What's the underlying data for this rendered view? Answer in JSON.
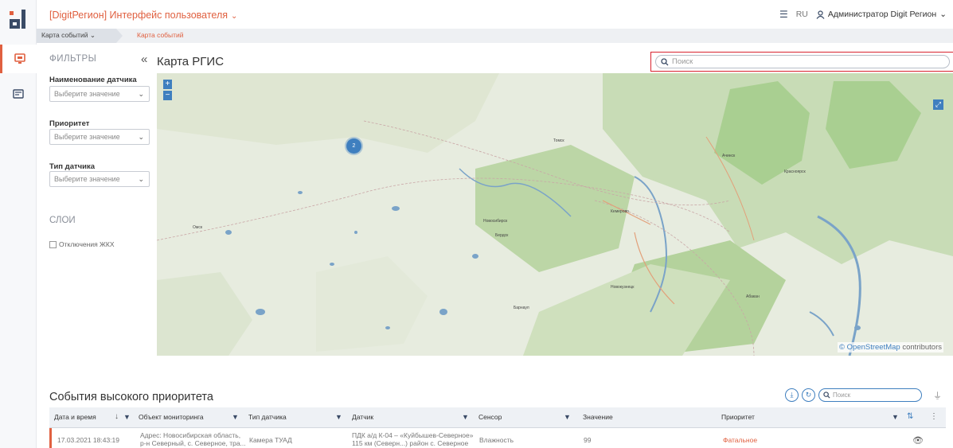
{
  "app": {
    "title": "[DigitРегион] Интерфейс пользователя",
    "language": "RU",
    "user": "Администратор Digit Регион"
  },
  "breadcrumbs": [
    "Карта событий",
    "Карта событий"
  ],
  "filters": {
    "title": "ФИЛЬТРЫ",
    "fields": [
      {
        "label": "Наименование датчика",
        "placeholder": "Выберите значение"
      },
      {
        "label": "Приоритет",
        "placeholder": "Выберите значение"
      },
      {
        "label": "Тип датчика",
        "placeholder": "Выберите значение"
      }
    ]
  },
  "layers": {
    "title": "СЛОИ",
    "options": [
      {
        "label": "Отключения ЖКХ",
        "checked": false
      }
    ]
  },
  "map": {
    "title": "Карта РГИС",
    "search_placeholder": "Поиск",
    "cluster_count": "2",
    "attribution_symbol": "©",
    "attribution_link": "OpenStreetMap",
    "attribution_rest": "contributors",
    "cities": [
      "Томск",
      "Ачинск",
      "Красноярск",
      "Омск",
      "Кемерово",
      "Новосибирск",
      "Бердск",
      "Новокузнецк",
      "Барнаул",
      "Абакан"
    ]
  },
  "events": {
    "title": "События высокого приоритета",
    "search_placeholder": "Поиск",
    "columns": [
      "Дата и время",
      "Объект мониторинга",
      "Тип датчика",
      "Датчик",
      "Сенсор",
      "Значение",
      "Приоритет"
    ],
    "rows": [
      {
        "datetime": "17.03.2021 18:43:19",
        "object_line1": "Адрес: Новосибирская область,",
        "object_line2": "р-н Северный, с. Северное, тра...",
        "sensor_type": "Камера ТУАД",
        "sensor_line1": "ПДК а/д К-04 – «Куйбышев-Северное»",
        "sensor_line2": "115 км (Северн...)  район с. Северное",
        "sensor": "Влажность",
        "value": "99",
        "priority": "Фатальное"
      }
    ]
  },
  "colors": {
    "accent": "#e06040",
    "blue": "#3f7fbf",
    "highlight": "#d9232f"
  }
}
